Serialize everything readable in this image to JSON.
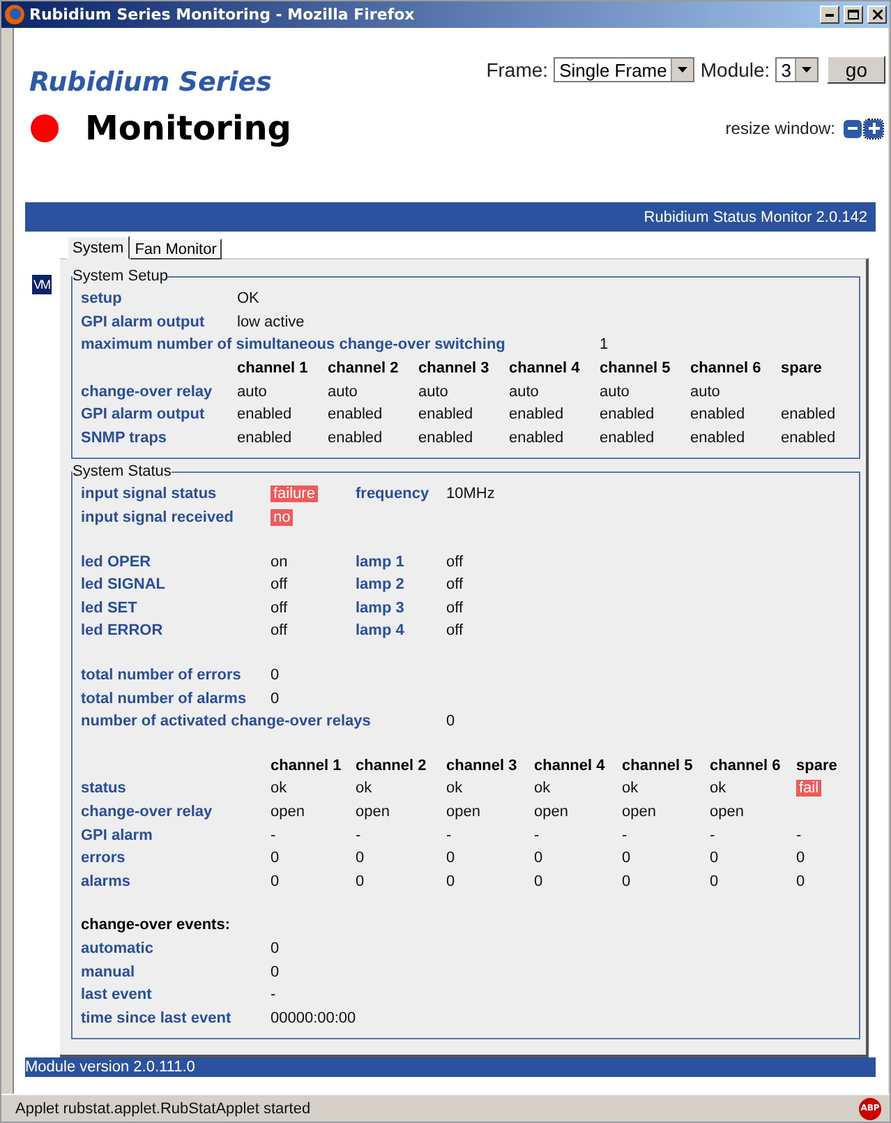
{
  "window": {
    "title": "Rubidium Series Monitoring - Mozilla Firefox"
  },
  "header": {
    "brand": "Rubidium Series",
    "title": "Monitoring",
    "alarm": true,
    "frame_label": "Frame:",
    "frame_value": "Single Frame",
    "module_label": "Module:",
    "module_value": "3",
    "go": "go",
    "resize_label": "resize window:"
  },
  "applet": {
    "title": "Rubidium Status Monitor 2.0.142",
    "side_badge": "VM",
    "footer": "Module version 2.0.111.0",
    "tabs": [
      {
        "label": "System",
        "selected": true
      },
      {
        "label": "Fan Monitor",
        "selected": false
      }
    ]
  },
  "system_setup": {
    "legend": "System Setup",
    "blocks": [
      {
        "rows": [
          {
            "kind": "pair",
            "label": "setup",
            "value": "OK",
            "alert": false
          },
          {
            "kind": "pair",
            "label": "GPI alarm output",
            "value": "low active",
            "alert": false
          },
          {
            "kind": "long_pair",
            "label": "maximum number of simultaneous change-over switching",
            "value": "1",
            "alert": false
          },
          {
            "kind": "header",
            "columns": [
              "channel 1",
              "channel 2",
              "channel 3",
              "channel 4",
              "channel 5",
              "channel 6",
              "spare"
            ]
          },
          {
            "kind": "table",
            "label": "change-over relay",
            "cells": [
              {
                "text": "auto",
                "alert": false
              },
              {
                "text": "auto",
                "alert": false
              },
              {
                "text": "auto",
                "alert": false
              },
              {
                "text": "auto",
                "alert": false
              },
              {
                "text": "auto",
                "alert": false
              },
              {
                "text": "auto",
                "alert": false
              },
              null
            ]
          },
          {
            "kind": "table",
            "label": "GPI alarm output",
            "cells": [
              {
                "text": "enabled",
                "alert": false
              },
              {
                "text": "enabled",
                "alert": false
              },
              {
                "text": "enabled",
                "alert": false
              },
              {
                "text": "enabled",
                "alert": false
              },
              {
                "text": "enabled",
                "alert": false
              },
              {
                "text": "enabled",
                "alert": false
              },
              {
                "text": "enabled",
                "alert": false
              }
            ]
          },
          {
            "kind": "table",
            "label": "SNMP traps",
            "cells": [
              {
                "text": "enabled",
                "alert": false
              },
              {
                "text": "enabled",
                "alert": false
              },
              {
                "text": "enabled",
                "alert": false
              },
              {
                "text": "enabled",
                "alert": false
              },
              {
                "text": "enabled",
                "alert": false
              },
              {
                "text": "enabled",
                "alert": false
              },
              {
                "text": "enabled",
                "alert": false
              }
            ]
          }
        ]
      }
    ]
  },
  "system_status": {
    "legend": "System Status",
    "blocks": [
      {
        "rows": [
          {
            "kind": "quad",
            "label": "input signal status",
            "value": "failure",
            "alert": true,
            "label_2": "frequency",
            "value_2": "10MHz"
          },
          {
            "kind": "pair",
            "label": "input signal received",
            "value": "no",
            "alert": true
          }
        ]
      },
      {
        "rows": [
          {
            "kind": "quad",
            "label": "led OPER",
            "value": "on",
            "alert": false,
            "label_2": "lamp 1",
            "value_2": "off"
          },
          {
            "kind": "quad",
            "label": "led SIGNAL",
            "value": "off",
            "alert": false,
            "label_2": "lamp 2",
            "value_2": "off"
          },
          {
            "kind": "quad",
            "label": "led SET",
            "value": "off",
            "alert": false,
            "label_2": "lamp 3",
            "value_2": "off"
          },
          {
            "kind": "quad",
            "label": "led ERROR",
            "value": "off",
            "alert": false,
            "label_2": "lamp 4",
            "value_2": "off"
          }
        ]
      },
      {
        "rows": [
          {
            "kind": "pair",
            "label": "total number of errors",
            "value": "0",
            "alert": false
          },
          {
            "kind": "pair",
            "label": "total number of alarms",
            "value": "0",
            "alert": false
          },
          {
            "kind": "long_pair",
            "label": "number of activated change-over relays",
            "value": "0",
            "alert": false
          }
        ]
      },
      {
        "rows": [
          {
            "kind": "header",
            "columns": [
              "channel 1",
              "channel 2",
              "channel 3",
              "channel 4",
              "channel 5",
              "channel 6",
              "spare"
            ]
          },
          {
            "kind": "table",
            "label": "status",
            "cells": [
              {
                "text": "ok",
                "alert": false
              },
              {
                "text": "ok",
                "alert": false
              },
              {
                "text": "ok",
                "alert": false
              },
              {
                "text": "ok",
                "alert": false
              },
              {
                "text": "ok",
                "alert": false
              },
              {
                "text": "ok",
                "alert": false
              },
              {
                "text": "fail",
                "alert": true
              }
            ]
          },
          {
            "kind": "table",
            "label": "change-over relay",
            "cells": [
              {
                "text": "open",
                "alert": false
              },
              {
                "text": "open",
                "alert": false
              },
              {
                "text": "open",
                "alert": false
              },
              {
                "text": "open",
                "alert": false
              },
              {
                "text": "open",
                "alert": false
              },
              {
                "text": "open",
                "alert": false
              },
              null
            ]
          },
          {
            "kind": "table",
            "label": "GPI alarm",
            "cells": [
              {
                "text": "-",
                "alert": false
              },
              {
                "text": "-",
                "alert": false
              },
              {
                "text": "-",
                "alert": false
              },
              {
                "text": "-",
                "alert": false
              },
              {
                "text": "-",
                "alert": false
              },
              {
                "text": "-",
                "alert": false
              },
              {
                "text": "-",
                "alert": false
              }
            ]
          },
          {
            "kind": "table",
            "label": "errors",
            "cells": [
              {
                "text": "0",
                "alert": false
              },
              {
                "text": "0",
                "alert": false
              },
              {
                "text": "0",
                "alert": false
              },
              {
                "text": "0",
                "alert": false
              },
              {
                "text": "0",
                "alert": false
              },
              {
                "text": "0",
                "alert": false
              },
              {
                "text": "0",
                "alert": false
              }
            ]
          },
          {
            "kind": "table",
            "label": "alarms",
            "cells": [
              {
                "text": "0",
                "alert": false
              },
              {
                "text": "0",
                "alert": false
              },
              {
                "text": "0",
                "alert": false
              },
              {
                "text": "0",
                "alert": false
              },
              {
                "text": "0",
                "alert": false
              },
              {
                "text": "0",
                "alert": false
              },
              {
                "text": "0",
                "alert": false
              }
            ]
          }
        ]
      },
      {
        "rows": [
          {
            "kind": "heading",
            "label": "change-over events:"
          },
          {
            "kind": "pair",
            "label": "automatic",
            "value": "0",
            "alert": false
          },
          {
            "kind": "pair",
            "label": "manual",
            "value": "0",
            "alert": false
          },
          {
            "kind": "pair",
            "label": "last event",
            "value": "-",
            "alert": false
          },
          {
            "kind": "pair",
            "label": "time since last event",
            "value": "00000:00:00",
            "alert": false
          }
        ]
      }
    ]
  },
  "status_bar": {
    "text": "Applet rubstat.applet.RubStatApplet started",
    "badge": "ABP"
  }
}
